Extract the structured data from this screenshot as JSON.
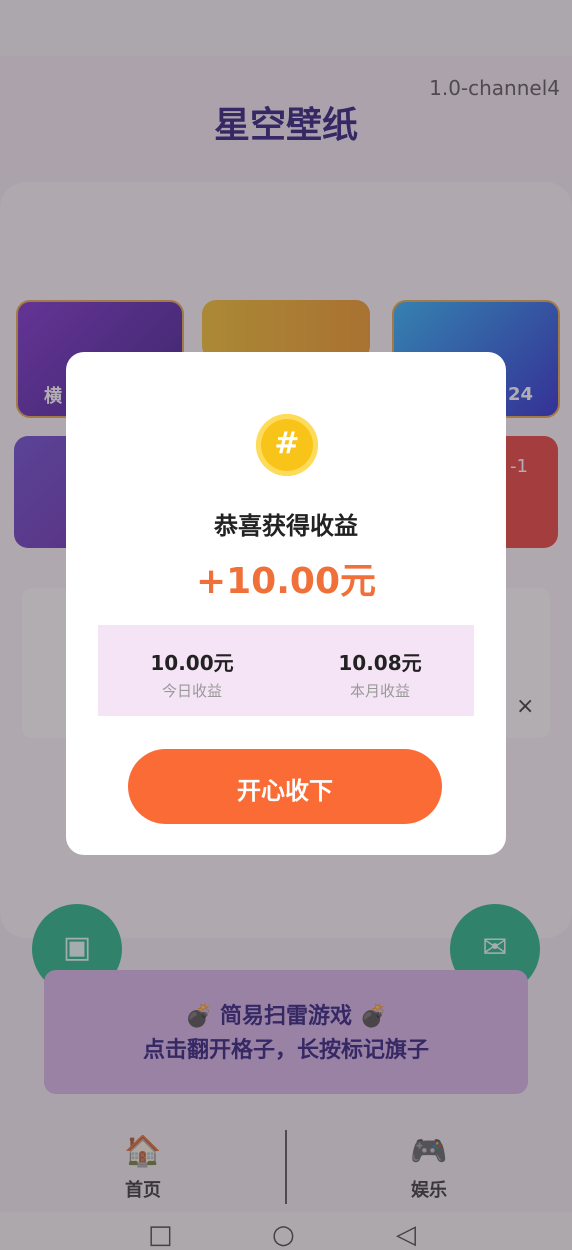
{
  "app": {
    "title": "星空壁纸",
    "version": "1.0-channel4"
  },
  "tiles": [
    {
      "label": "横",
      "color": "#6b2fc8"
    },
    {
      "label": "",
      "color": "#f3a826"
    },
    {
      "label": "24",
      "color": "#2a6cf0"
    },
    {
      "label": "",
      "color": "#6a3ec8"
    },
    {
      "label": "-1",
      "color": "#e8403a"
    }
  ],
  "ad": {
    "close_symbol": "×"
  },
  "game_banner": {
    "line1": "💣 简易扫雷游戏 💣",
    "line2": "点击翻开格子，长按标记旗子"
  },
  "bottom_nav": [
    {
      "label": "首页",
      "icon": "home-icon",
      "glyph": "🏠"
    },
    {
      "label": "娱乐",
      "icon": "gamepad-icon",
      "glyph": "🎮"
    }
  ],
  "system_nav": {
    "recent": "□",
    "home": "○",
    "back": "◁"
  },
  "dialog": {
    "coin_symbol": "#",
    "title": "恭喜获得收益",
    "amount": "+10.00元",
    "stats": [
      {
        "value": "10.00元",
        "caption": "今日收益"
      },
      {
        "value": "10.08元",
        "caption": "本月收益"
      }
    ],
    "confirm_label": "开心收下"
  },
  "colors": {
    "accent": "#fb6b35",
    "amount": "#f0703a",
    "stats_bg": "#f5e4f6",
    "title": "#2a1a7a",
    "fab": "#21b585"
  }
}
